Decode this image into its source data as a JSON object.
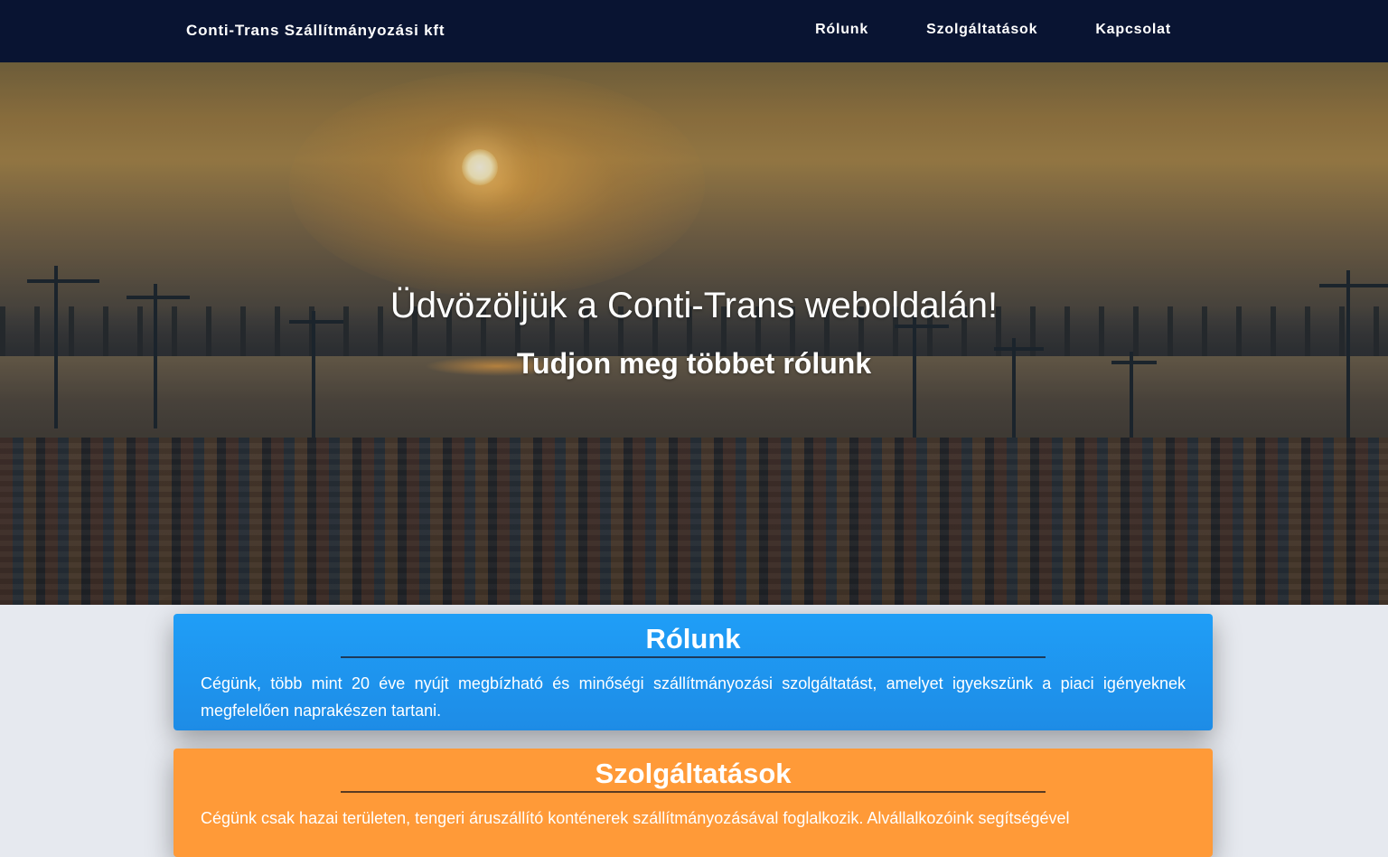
{
  "navbar": {
    "brand": "Conti-Trans Szállítmányozási kft",
    "links": [
      {
        "label": "Rólunk"
      },
      {
        "label": "Szolgáltatások"
      },
      {
        "label": "Kapcsolat"
      }
    ],
    "background_color": "#091432"
  },
  "hero": {
    "title": "Üdvözöljük a Conti-Trans weboldalán!",
    "subtitle": "Tudjon meg többet rólunk",
    "image_description_icon": "port-sunset-image"
  },
  "sections": {
    "about": {
      "title": "Rólunk",
      "text": "Cégünk, több mint 20 éve nyújt megbízható és minőségi szállítmányozási szolgáltatást, amelyet igyekszünk a piaci igényeknek megfelelően naprakészen tartani.",
      "color": "#1f9ef7"
    },
    "services": {
      "title": "Szolgáltatások",
      "text": "Cégünk csak hazai területen, tengeri áruszállító konténerek szállítmányozásával foglalkozik. Alvállalkozóink segítségével",
      "color": "#ff9a38"
    }
  }
}
